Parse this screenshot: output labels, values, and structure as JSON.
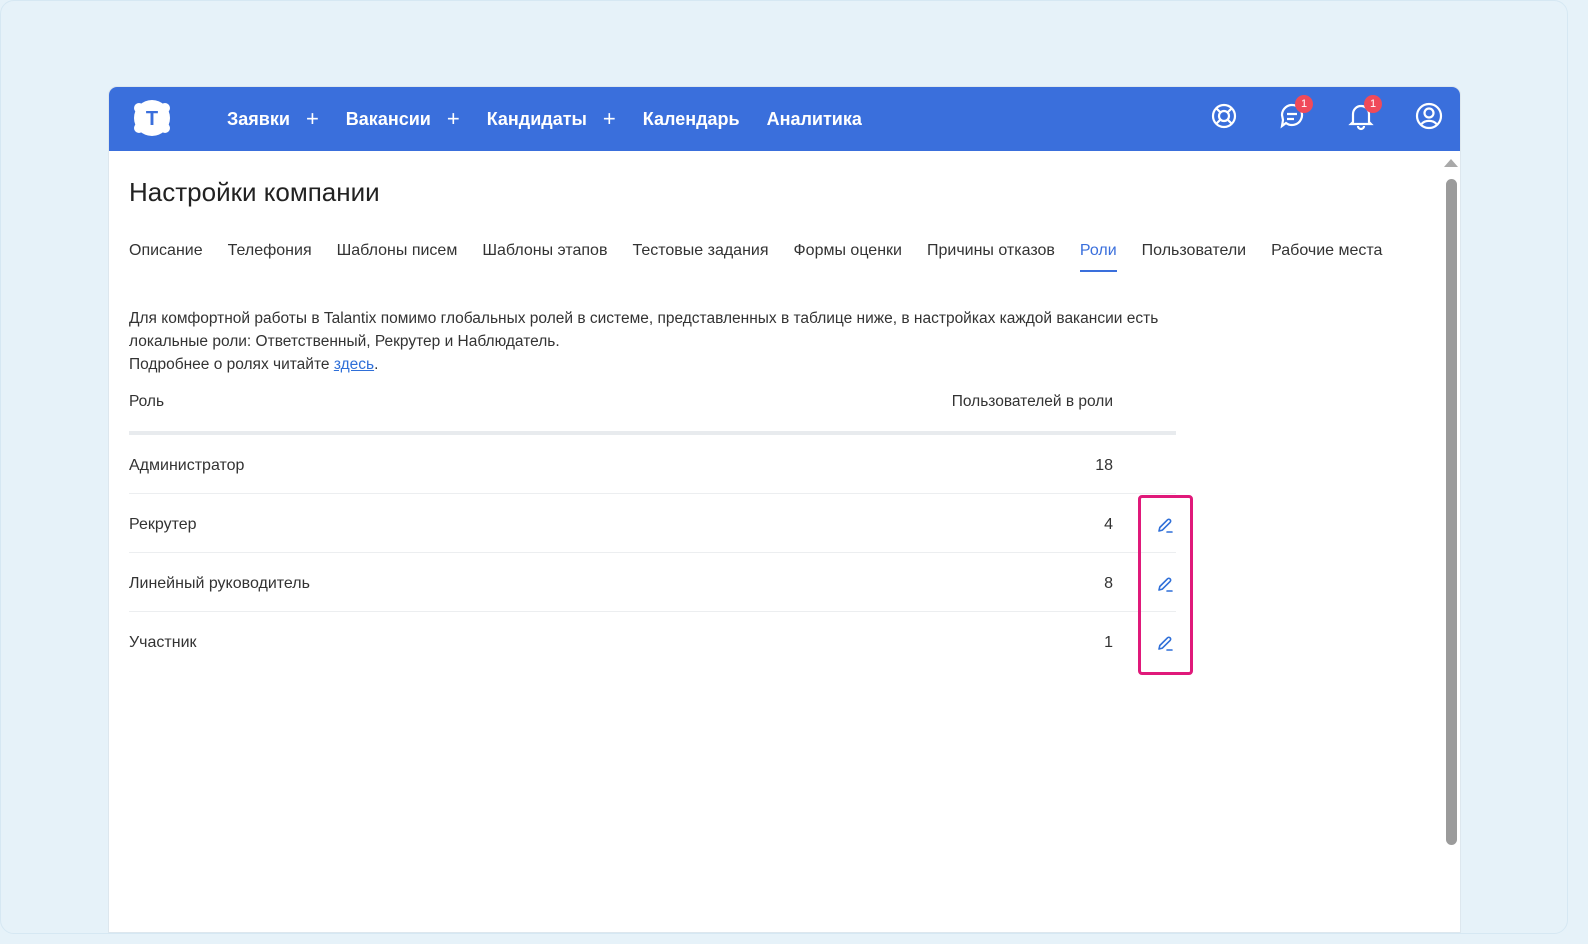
{
  "header": {
    "logo_letter": "T",
    "nav": [
      {
        "label": "Заявки",
        "plus": "+"
      },
      {
        "label": "Вакансии",
        "plus": "+"
      },
      {
        "label": "Кандидаты",
        "plus": "+"
      },
      {
        "label": "Календарь",
        "plus": ""
      },
      {
        "label": "Аналитика",
        "plus": ""
      }
    ],
    "icons": {
      "help": "lifebuoy-icon",
      "messages": "chat-icon",
      "messages_badge": "1",
      "notifications": "bell-icon",
      "notifications_badge": "1",
      "profile": "user-icon"
    }
  },
  "page": {
    "title": "Настройки компании",
    "tabs": [
      "Описание",
      "Телефония",
      "Шаблоны писем",
      "Шаблоны этапов",
      "Тестовые задания",
      "Формы оценки",
      "Причины отказов",
      "Роли",
      "Пользователи",
      "Рабочие места"
    ],
    "active_tab": "Роли",
    "intro_line1": "Для комфортной работы в Talantix помимо глобальных ролей в системе, представленных в таблице ниже, в настройках каждой вакансии есть локальные роли: Ответственный, Рекрутер и Наблюдатель.",
    "intro_line2_prefix": "Подробнее о ролях читайте ",
    "intro_link": "здесь",
    "intro_line2_suffix": "."
  },
  "table": {
    "col_role": "Роль",
    "col_count": "Пользователей в роли",
    "rows": [
      {
        "role": "Администратор",
        "count": "18",
        "editable": false
      },
      {
        "role": "Рекрутер",
        "count": "4",
        "editable": true
      },
      {
        "role": "Линейный руководитель",
        "count": "8",
        "editable": true
      },
      {
        "role": "Участник",
        "count": "1",
        "editable": true
      }
    ]
  },
  "colors": {
    "header_bg": "#3a6fdc",
    "accent": "#3a6fdc",
    "highlight": "#e0197a",
    "badge": "#f04a5a"
  }
}
